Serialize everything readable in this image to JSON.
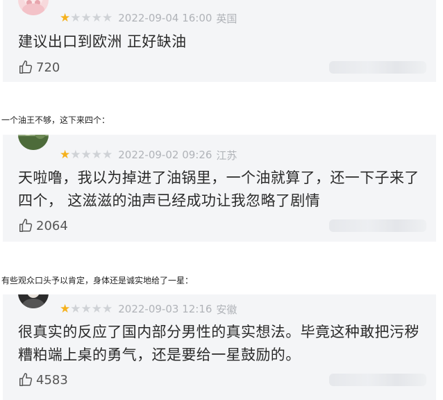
{
  "comments": [
    {
      "rating": 1,
      "max_rating": 5,
      "date": "2022-09-04 16:00",
      "location": "英国",
      "text": "建议出口到欧洲 正好缺油",
      "likes": "720"
    },
    {
      "rating": 1,
      "max_rating": 5,
      "date": "2022-09-02 09:26",
      "location": "江苏",
      "text": "天啦噜，我以为掉进了油锅里，一个油就算了，还一下子来了四个， 这滋滋的油声已经成功让我忽略了剧情",
      "likes": "2064"
    },
    {
      "rating": 1,
      "max_rating": 5,
      "date": "2022-09-03 12:16",
      "location": "安徽",
      "text": "很真实的反应了国内部分男性的真实想法。毕竟这种敢把污秽糟粕端上桌的勇气，还是要给一星鼓励的。",
      "likes": "4583"
    }
  ],
  "captions": {
    "caption_1": "一个油王不够，这下来四个：",
    "caption_2": "有些观众口头予以肯定，身体还是诚实地给了一星："
  },
  "colors": {
    "card_bg": "#f4f5f7",
    "star_on": "#f5b11d",
    "star_off": "#cfd2d6",
    "meta_text": "#b0b3b8"
  },
  "icons": {
    "like": "thumbs-up-icon",
    "rating": "star-icon"
  }
}
